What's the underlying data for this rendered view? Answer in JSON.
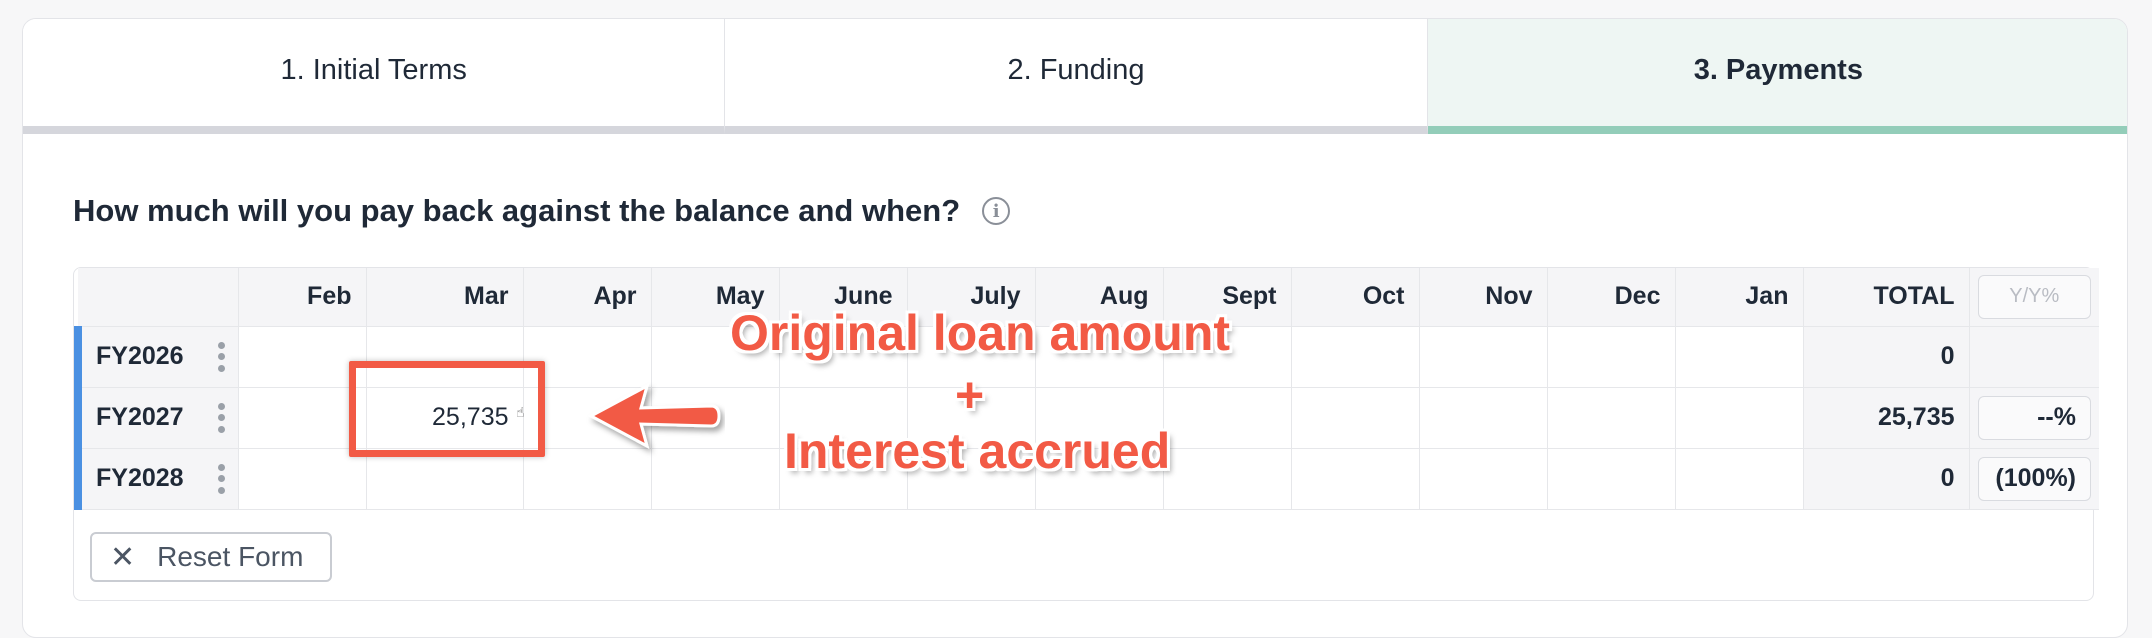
{
  "tabs": [
    {
      "label": "1. Initial Terms",
      "active": false
    },
    {
      "label": "2. Funding",
      "active": false
    },
    {
      "label": "3. Payments",
      "active": true
    }
  ],
  "question": "How much will you pay back against the balance and when?",
  "info_icon": "info-icon",
  "table": {
    "months": [
      "Feb",
      "Mar",
      "Apr",
      "May",
      "June",
      "July",
      "Aug",
      "Sept",
      "Oct",
      "Nov",
      "Dec",
      "Jan"
    ],
    "total_header": "TOTAL",
    "yoy_placeholder": "Y/Y%",
    "rows": [
      {
        "label": "FY2026",
        "cells": [
          "",
          "",
          "",
          "",
          "",
          "",
          "",
          "",
          "",
          "",
          "",
          ""
        ],
        "total": "0",
        "yoy": ""
      },
      {
        "label": "FY2027",
        "cells": [
          "",
          "25,735",
          "",
          "",
          "",
          "",
          "",
          "",
          "",
          "",
          "",
          ""
        ],
        "total": "25,735",
        "yoy": "--%"
      },
      {
        "label": "FY2028",
        "cells": [
          "",
          "",
          "",
          "",
          "",
          "",
          "",
          "",
          "",
          "",
          "",
          ""
        ],
        "total": "0",
        "yoy": "(100%)"
      }
    ]
  },
  "reset_button": "Reset Form",
  "annotation": {
    "line1": "Original loan amount",
    "line2": "+",
    "line3": "Interest accrued",
    "color": "#f25a45"
  },
  "colors": {
    "active_tab_underline": "#93cdb9",
    "row_marker": "#4a90e2"
  }
}
